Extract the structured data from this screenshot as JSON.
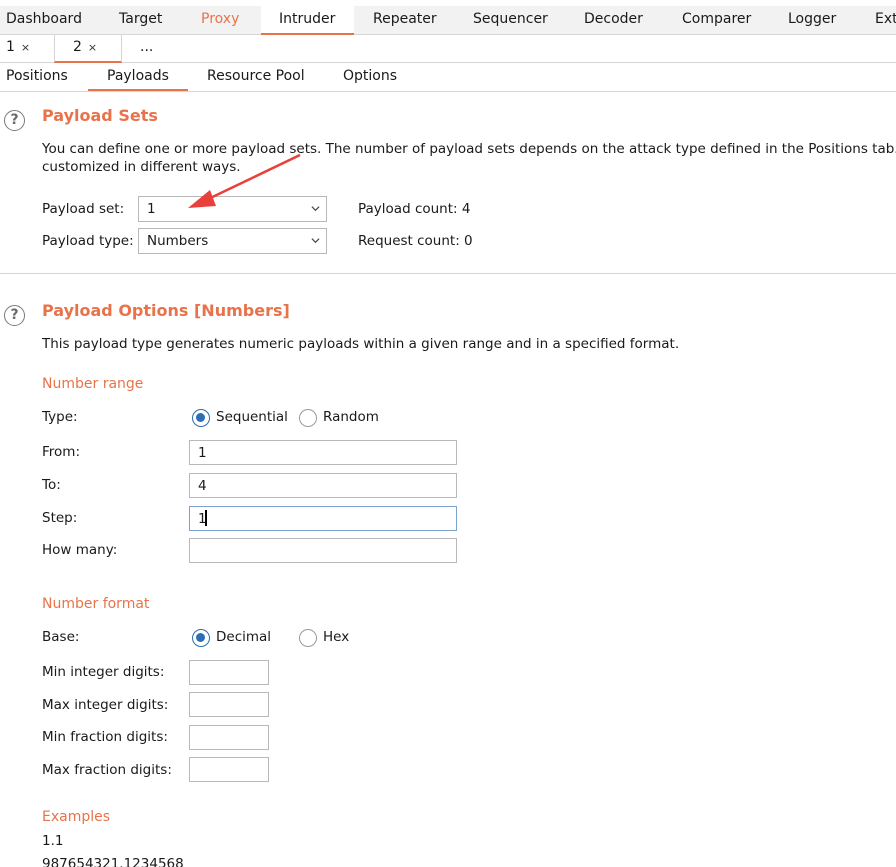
{
  "tool_tabs": [
    "Dashboard",
    "Target",
    "Proxy",
    "Intruder",
    "Repeater",
    "Sequencer",
    "Decoder",
    "Comparer",
    "Logger",
    "Ext"
  ],
  "sub_tabs": [
    {
      "label": "1",
      "close": "×"
    },
    {
      "label": "2",
      "close": "×"
    },
    {
      "label": "..."
    }
  ],
  "section_tabs": [
    "Positions",
    "Payloads",
    "Resource Pool",
    "Options"
  ],
  "payload_sets": {
    "help_icon": "?",
    "title": "Payload Sets",
    "description_line1": "You can define one or more payload sets. The number of payload sets depends on the attack type defined in the Positions tab.",
    "description_line2": "customized in different ways.",
    "payload_set_label": "Payload set:",
    "payload_set_value": "1",
    "payload_type_label": "Payload type:",
    "payload_type_value": "Numbers",
    "payload_count": "Payload count: 4",
    "request_count": "Request count: 0"
  },
  "payload_options": {
    "help_icon": "?",
    "title": "Payload Options [Numbers]",
    "description": "This payload type generates numeric payloads within a given range and in a specified format.",
    "number_range": {
      "title": "Number range",
      "type_label": "Type:",
      "sequential": "Sequential",
      "random": "Random",
      "from_label": "From:",
      "from_value": "1",
      "to_label": "To:",
      "to_value": "4",
      "step_label": "Step:",
      "step_value": "1",
      "how_many_label": "How many:",
      "how_many_value": ""
    },
    "number_format": {
      "title": "Number format",
      "base_label": "Base:",
      "decimal": "Decimal",
      "hex": "Hex",
      "min_int_label": "Min integer digits:",
      "max_int_label": "Max integer digits:",
      "min_frac_label": "Min fraction digits:",
      "max_frac_label": "Max fraction digits:"
    },
    "examples": {
      "title": "Examples",
      "line1": "1.1",
      "line2": "987654321.1234568"
    }
  },
  "colors": {
    "accent": "#e8734a",
    "radio": "#2d6db4",
    "arrow": "#e8403a"
  }
}
